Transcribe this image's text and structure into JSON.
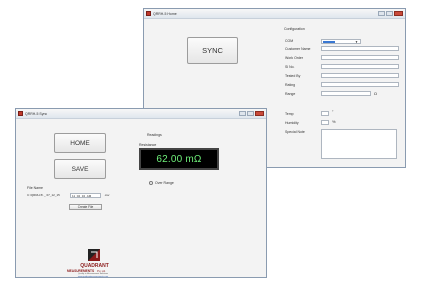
{
  "home_window": {
    "title": "QRRH-5 Home",
    "sync_label": "SYNC",
    "configuration_label": "Configuration",
    "com_label": "COM",
    "com_value": "COM1",
    "fields": [
      {
        "label": "Customer Name"
      },
      {
        "label": "Work Order"
      },
      {
        "label": "Sl No."
      },
      {
        "label": "Tested By"
      },
      {
        "label": "Rating"
      },
      {
        "label": "Range"
      }
    ],
    "range_unit": "Ω",
    "temp_label": "Temp",
    "temp_unit": "°",
    "humidity_label": "Humidity",
    "humidity_unit": "%",
    "special_note_label": "Special Note"
  },
  "sync_window": {
    "title": "QRRH-5 Sync",
    "home_label": "HOME",
    "save_label": "SAVE",
    "readings_label": "Readings",
    "resistance_label": "Resistance",
    "reading_value": "62.00 mΩ",
    "over_range_label": "Over Range",
    "file_name_label": "File Name",
    "path_text": "C:\\QRRH-5\\ _ 07_12_15",
    "file_value": "11_02_32_AM",
    "file_ext": ".csv",
    "create_file_label": "Create File"
  },
  "logo": {
    "line1": "QUADRANT",
    "line2": "MEASUREMENTS",
    "suffix": "Pvt. Ltd.",
    "tagline": "Quality in Measurement Solutions",
    "website": "www.quadrantmeasurements.com",
    "colors": {
      "primary": "#8b1a1a",
      "dark": "#222222"
    }
  },
  "display_color": "#6ff07a"
}
